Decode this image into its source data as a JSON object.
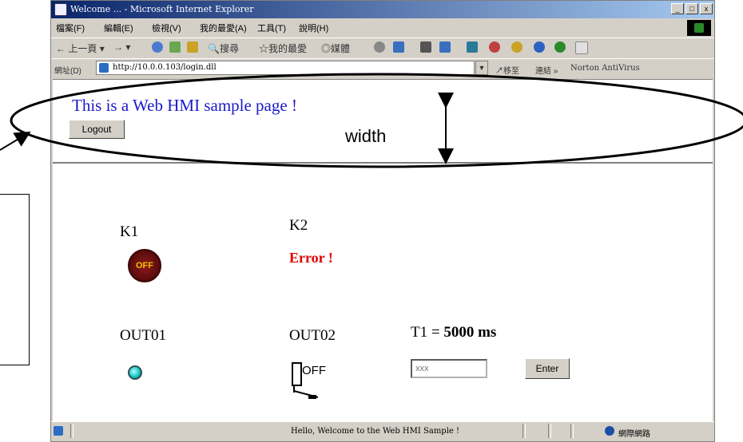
{
  "window": {
    "title": "Welcome ... - Microsoft Internet Explorer",
    "controls": [
      "_",
      "□",
      "x"
    ]
  },
  "menu": [
    "檔案(F)",
    "編輯(E)",
    "檢視(V)",
    "我的最愛(A)",
    "工具(T)",
    "說明(H)"
  ],
  "toolbar": {
    "back": "上一頁",
    "search": "搜尋",
    "favorites": "我的最愛",
    "media": "媒體"
  },
  "address": {
    "label": "網址(D)",
    "url": "http://10.0.0.103/login.dll",
    "go": "移至",
    "links": "連結 »",
    "norton": "Norton AntiVirus"
  },
  "page": {
    "logout_label": "Logout",
    "heading": "This is a Web HMI sample page !",
    "k1_label": "K1",
    "k1_button": "OFF",
    "k2_label": "K2",
    "k2_status": "Error !",
    "out01_label": "OUT01",
    "out02_label": "OUT02",
    "out02_switch": "OFF",
    "t1_prefix": "T1 = ",
    "t1_value": "5000 ms",
    "t1_placeholder": "xxx",
    "enter_label": "Enter"
  },
  "status": {
    "text": "Hello, Welcome to the Web HMI Sample !",
    "zone": "網際網路"
  },
  "annotation": {
    "width_label": "width"
  },
  "colors": {
    "heading": "#1a1acc",
    "error": "#e00000",
    "led": "#10c0c0",
    "titlebar": "#0a246a"
  }
}
